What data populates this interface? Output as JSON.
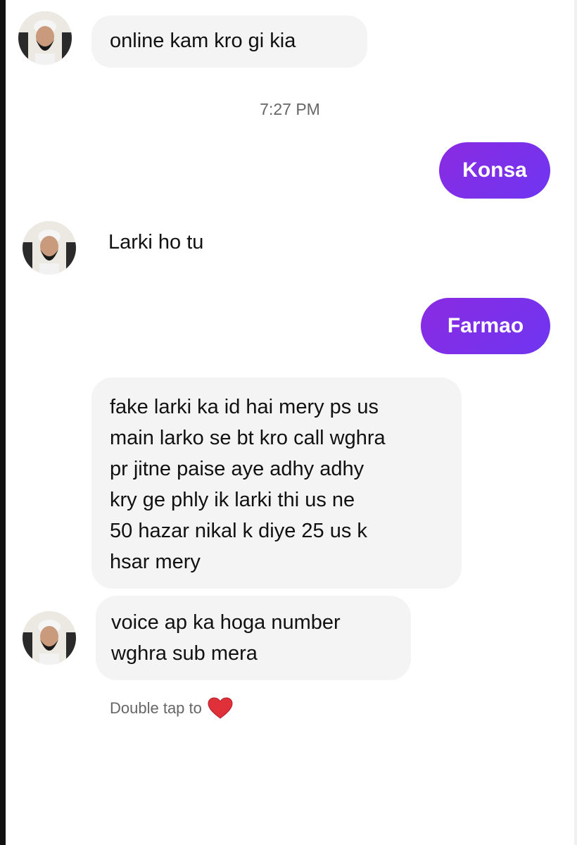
{
  "messages": {
    "m1": "online kam kro gi kia",
    "timestamp": "7:27 PM",
    "m2": "Konsa",
    "m3": "Larki ho tu",
    "m4": "Farmao",
    "m5_lines": [
      "fake larki ka id hai mery ps us",
      "main larko se bt kro call wghra",
      "pr jitne paise aye adhy adhy",
      "kry ge phly ik larki thi us ne",
      "50 hazar nikal k diye 25 us k",
      "hsar mery"
    ],
    "m6_lines": [
      "voice ap ka hoga number",
      "wghra sub mera"
    ]
  },
  "hint": {
    "text": "Double tap to",
    "icon": "heart-icon"
  },
  "colors": {
    "outgoing_bubble": "#7b2ff2",
    "incoming_bubble": "#f4f4f4",
    "heart": "#e0303a"
  }
}
